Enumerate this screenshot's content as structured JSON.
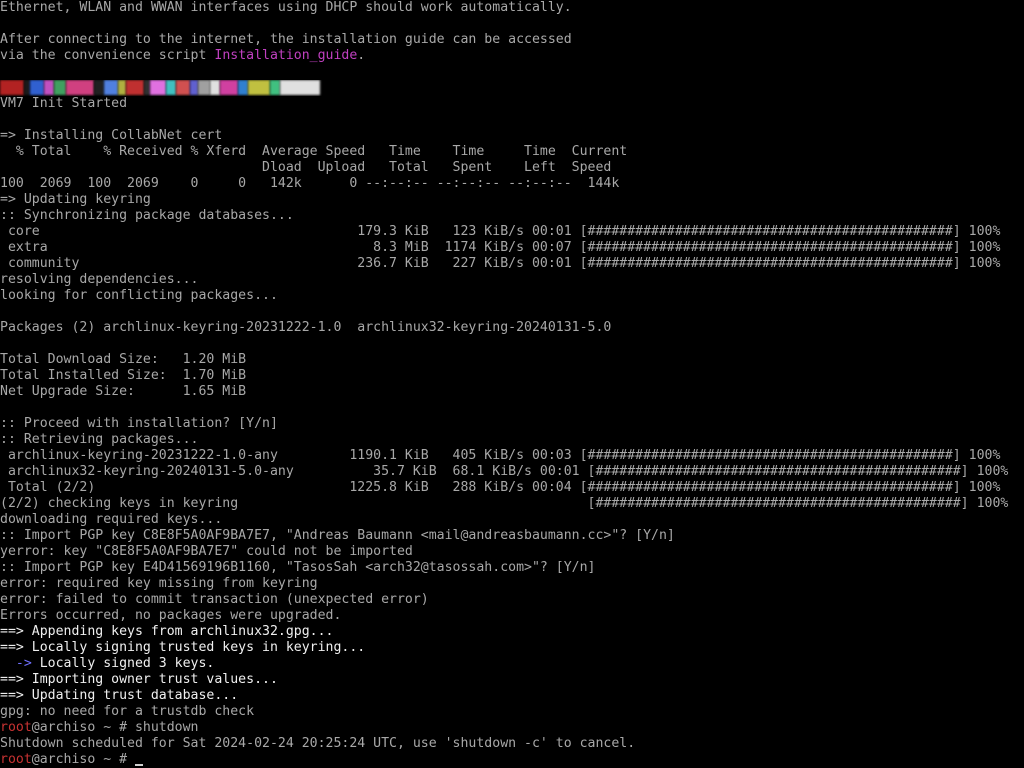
{
  "terminal": {
    "lines": [
      [
        {
          "t": "Ethernet, WLAN and WWAN interfaces using DHCP should work automatically.",
          "c": ""
        }
      ],
      [
        {
          "t": "",
          "c": ""
        }
      ],
      [
        {
          "t": "After connecting to the internet, the installation guide can be accessed",
          "c": ""
        }
      ],
      [
        {
          "t": "via the convenience script ",
          "c": ""
        },
        {
          "t": "Installation_guide",
          "c": "seg-magenta"
        },
        {
          "t": ".",
          "c": ""
        }
      ],
      [
        {
          "t": "",
          "c": ""
        }
      ],
      [
        {
          "t": "",
          "c": "",
          "banner": true
        }
      ],
      [
        {
          "t": "VM7 Init Started",
          "c": ""
        }
      ],
      [
        {
          "t": "",
          "c": ""
        }
      ],
      [
        {
          "t": "=> Installing CollabNet cert",
          "c": ""
        }
      ],
      [
        {
          "t": "  % Total    % Received % Xferd  Average Speed   Time    Time     Time  Current",
          "c": ""
        }
      ],
      [
        {
          "t": "                                 Dload  Upload   Total   Spent    Left  Speed",
          "c": ""
        }
      ],
      [
        {
          "t": "100  2069  100  2069    0     0   142k      0 --:--:-- --:--:-- --:--:--  144k",
          "c": ""
        }
      ],
      [
        {
          "t": "=> Updating keyring",
          "c": ""
        }
      ],
      [
        {
          "t": ":: Synchronizing package databases...",
          "c": ""
        }
      ],
      [
        {
          "t": " core                                        179.3 KiB   123 KiB/s 00:01 [##############################################] 100%",
          "c": ""
        }
      ],
      [
        {
          "t": " extra                                         8.3 MiB  1174 KiB/s 00:07 [##############################################] 100%",
          "c": ""
        }
      ],
      [
        {
          "t": " community                                   236.7 KiB   227 KiB/s 00:01 [##############################################] 100%",
          "c": ""
        }
      ],
      [
        {
          "t": "resolving dependencies...",
          "c": ""
        }
      ],
      [
        {
          "t": "looking for conflicting packages...",
          "c": ""
        }
      ],
      [
        {
          "t": "",
          "c": ""
        }
      ],
      [
        {
          "t": "Packages (2) archlinux-keyring-20231222-1.0  archlinux32-keyring-20240131-5.0",
          "c": ""
        }
      ],
      [
        {
          "t": "",
          "c": ""
        }
      ],
      [
        {
          "t": "Total Download Size:   1.20 MiB",
          "c": ""
        }
      ],
      [
        {
          "t": "Total Installed Size:  1.70 MiB",
          "c": ""
        }
      ],
      [
        {
          "t": "Net Upgrade Size:      1.65 MiB",
          "c": ""
        }
      ],
      [
        {
          "t": "",
          "c": ""
        }
      ],
      [
        {
          "t": ":: Proceed with installation? [Y/n]",
          "c": ""
        }
      ],
      [
        {
          "t": ":: Retrieving packages...",
          "c": ""
        }
      ],
      [
        {
          "t": " archlinux-keyring-20231222-1.0-any         1190.1 KiB   405 KiB/s 00:03 [##############################################] 100%",
          "c": ""
        }
      ],
      [
        {
          "t": " archlinux32-keyring-20240131-5.0-any          35.7 KiB  68.1 KiB/s 00:01 [##############################################] 100%",
          "c": ""
        }
      ],
      [
        {
          "t": " Total (2/2)                                1225.8 KiB   288 KiB/s 00:04 [##############################################] 100%",
          "c": ""
        }
      ],
      [
        {
          "t": "(2/2) checking keys in keyring                                            [##############################################] 100%",
          "c": ""
        }
      ],
      [
        {
          "t": "downloading required keys...",
          "c": ""
        }
      ],
      [
        {
          "t": ":: Import PGP key C8E8F5A0AF9BA7E7, \"Andreas Baumann <mail@andreasbaumann.cc>\"? [Y/n]",
          "c": ""
        }
      ],
      [
        {
          "t": "yerror: key \"C8E8F5A0AF9BA7E7\" could not be imported",
          "c": ""
        }
      ],
      [
        {
          "t": ":: Import PGP key E4D41569196B1160, \"TasosSah <arch32@tasossah.com>\"? [Y/n]",
          "c": ""
        }
      ],
      [
        {
          "t": "error: required key missing from keyring",
          "c": ""
        }
      ],
      [
        {
          "t": "error: failed to commit transaction (unexpected error)",
          "c": ""
        }
      ],
      [
        {
          "t": "Errors occurred, no packages were upgraded.",
          "c": ""
        }
      ],
      [
        {
          "t": "==> Appending keys from archlinux32.gpg...",
          "c": "seg-bright"
        }
      ],
      [
        {
          "t": "==> Locally signing trusted keys in keyring...",
          "c": "seg-bright"
        }
      ],
      [
        {
          "t": "  -> ",
          "c": "seg-blue"
        },
        {
          "t": "Locally signed 3 keys.",
          "c": "seg-bright"
        }
      ],
      [
        {
          "t": "==> Importing owner trust values...",
          "c": "seg-bright"
        }
      ],
      [
        {
          "t": "==> Updating trust database...",
          "c": "seg-bright"
        }
      ],
      [
        {
          "t": "gpg: no need for a trustdb check",
          "c": ""
        }
      ],
      [
        {
          "t": "root",
          "c": "seg-red"
        },
        {
          "t": "@archiso ~ # shutdown",
          "c": ""
        }
      ],
      [
        {
          "t": "Shutdown scheduled for Sat 2024-02-24 20:25:24 UTC, use 'shutdown -c' to cancel.",
          "c": ""
        }
      ],
      [
        {
          "t": "root",
          "c": "seg-red"
        },
        {
          "t": "@archiso ~ # ",
          "c": ""
        },
        {
          "t": "",
          "c": "",
          "cursor": true
        }
      ]
    ],
    "banner_colors": [
      "#b22222",
      "#1a1a1a",
      "#3060d0",
      "#c050c0",
      "#40a060",
      "#d04080",
      "#202020",
      "#5080e0",
      "#b0b040",
      "#c03030",
      "#303030",
      "#e070e0",
      "#40c0c0",
      "#d05050",
      "#6060d0",
      "#a0a0a0",
      "#e0e0e0",
      "#d040a0",
      "#3080d0",
      "#c0c040",
      "#40c080",
      "#e0e0e0"
    ]
  }
}
